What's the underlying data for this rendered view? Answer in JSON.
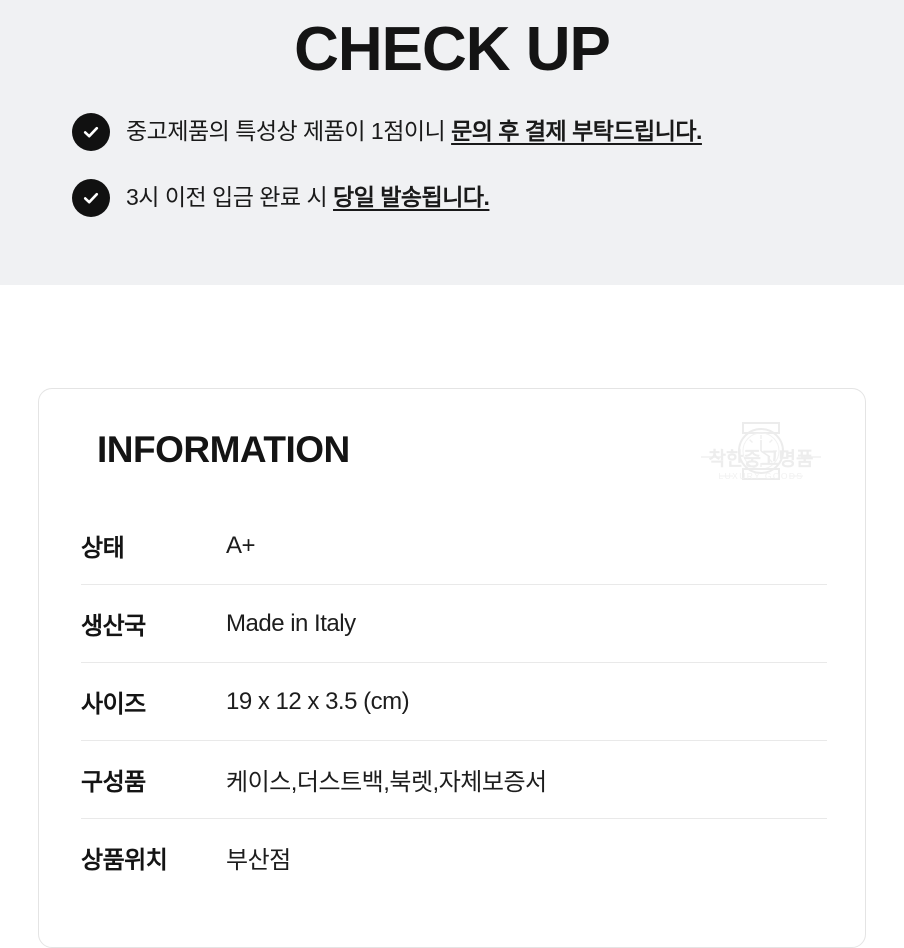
{
  "banner": {
    "title": "CHECK UP",
    "background_color": "#f0f1f3",
    "badge_color": "#111111",
    "items": [
      {
        "icon": "check-circle-icon",
        "text_plain": "중고제품의 특성상 제품이 1점이니 ",
        "text_emphasis": "문의 후 결제 부탁드립니다."
      },
      {
        "icon": "check-circle-icon",
        "text_plain": "3시 이전 입금 완료 시 ",
        "text_emphasis": "당일 발송됩니다."
      }
    ]
  },
  "information_card": {
    "title": "INFORMATION",
    "border_color": "#e4e4e4",
    "watermark": {
      "icon": "watch-logo-icon",
      "brand_ko": "착한중고명품",
      "brand_en": "LUXURY GOODS"
    },
    "rows": [
      {
        "label": "상태",
        "value": "A+"
      },
      {
        "label": "생산국",
        "value": "Made in Italy"
      },
      {
        "label": "사이즈",
        "value": "19 x 12 x 3.5 (cm)"
      },
      {
        "label": "구성품",
        "value": "케이스,더스트백,북렛,자체보증서"
      },
      {
        "label": "상품위치",
        "value": "부산점"
      }
    ]
  }
}
